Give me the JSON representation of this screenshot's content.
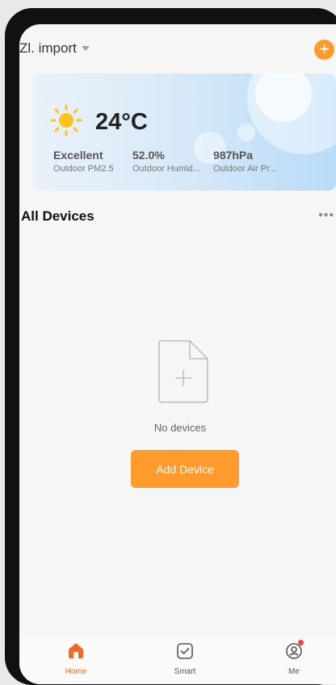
{
  "header": {
    "home_name": "Zl. import",
    "add_icon": "plus-circle-icon"
  },
  "weather": {
    "icon": "sun-icon",
    "temperature": "24°C",
    "stats": [
      {
        "value": "Excellent",
        "label": "Outdoor PM2.5"
      },
      {
        "value": "52.0%",
        "label": "Outdoor Humid..."
      },
      {
        "value": "987hPa",
        "label": "Outdoor Air Pr..."
      }
    ]
  },
  "devices": {
    "title": "All Devices",
    "more_icon": "ellipsis-icon",
    "empty_text": "No devices",
    "add_button": "Add Device"
  },
  "tabs": [
    {
      "label": "Home",
      "icon": "home-icon",
      "active": true
    },
    {
      "label": "Smart",
      "icon": "checkbox-icon",
      "active": false
    },
    {
      "label": "Me",
      "icon": "user-icon",
      "active": false,
      "notification": true
    }
  ],
  "colors": {
    "accent": "#ff9a2c",
    "tab_active": "#f16b24",
    "tab_inactive": "#555555"
  }
}
